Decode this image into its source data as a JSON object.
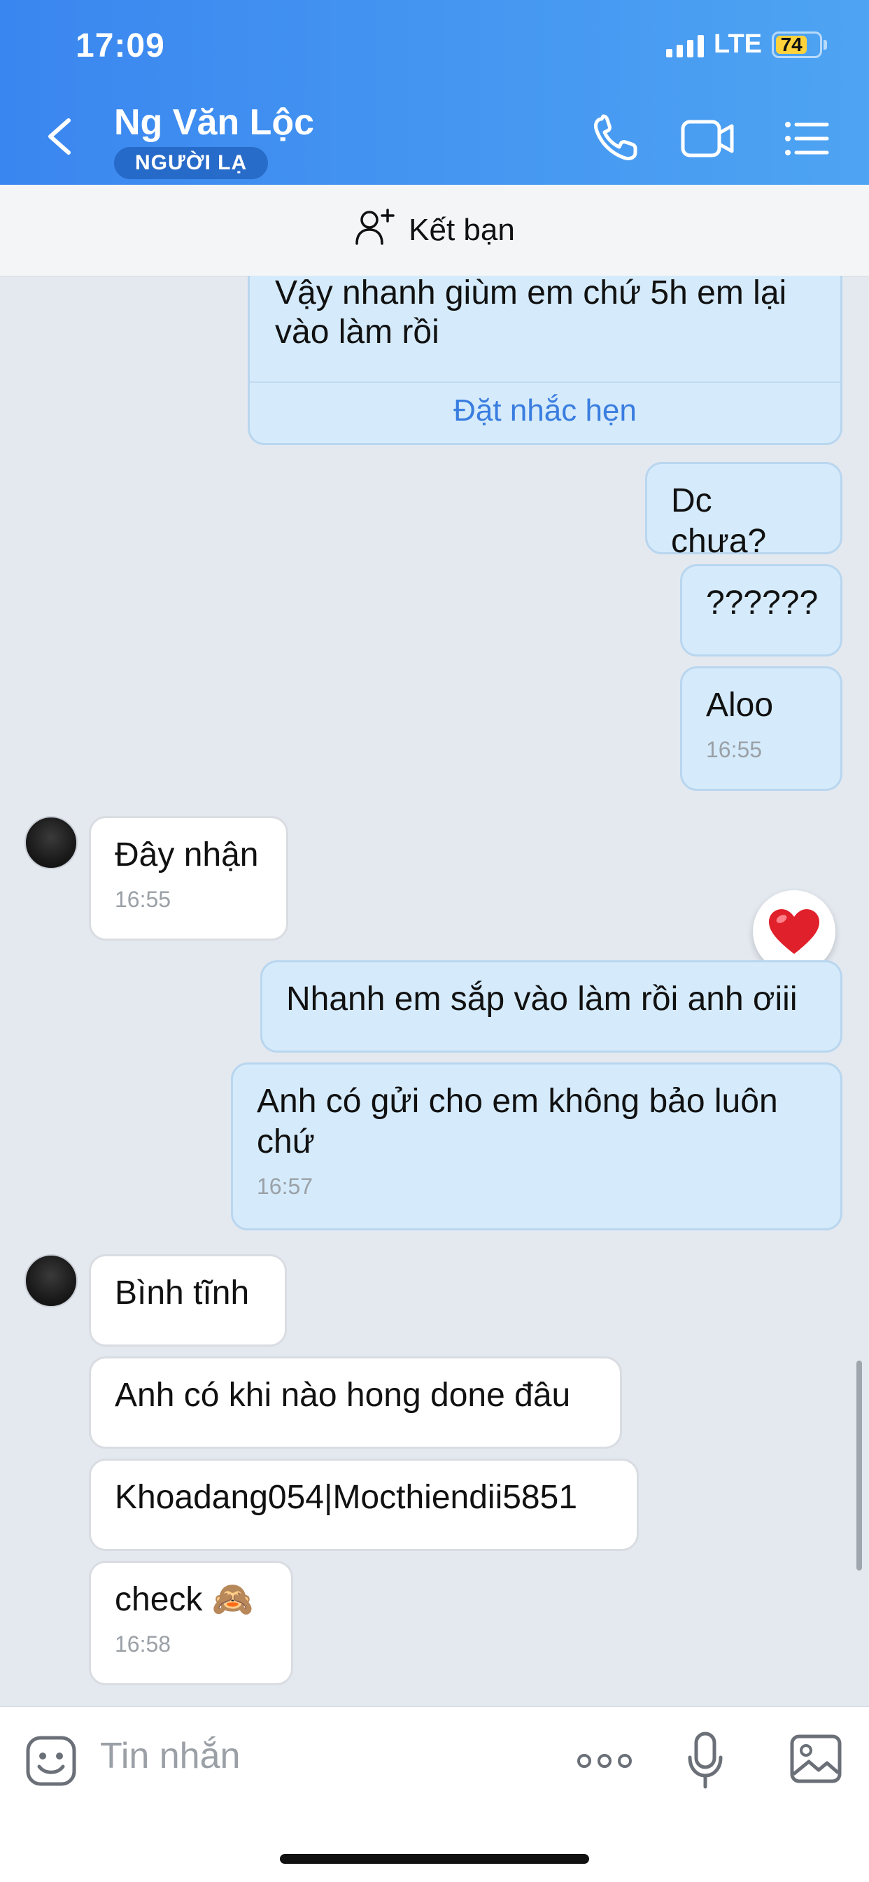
{
  "status_bar": {
    "time": "17:09",
    "network": "LTE",
    "battery": "74",
    "battery_level": 0.74
  },
  "header": {
    "contact_name": "Ng Văn Lộc",
    "badge": "NGƯỜI LẠ",
    "icons": [
      "back-chevron-icon",
      "phone-icon",
      "video-call-icon",
      "menu-list-icon"
    ],
    "accent_color": "#3a86f0"
  },
  "friend_bar": {
    "label": "Kết bạn",
    "icon": "add-person-icon"
  },
  "messages": [
    {
      "from": "me",
      "lines": [
        "Vậy nhanh giùm em chứ 5h em lại",
        "vào làm rồi"
      ],
      "action": "Đặt nhắc hẹn"
    },
    {
      "from": "me",
      "text": "Dc chưa?"
    },
    {
      "from": "me",
      "text": "??????"
    },
    {
      "from": "me",
      "text": "Aloo",
      "time": "16:55"
    },
    {
      "from": "them",
      "text": "Đây nhận",
      "time": "16:55",
      "avatar": true
    },
    {
      "from": "me",
      "text": "Nhanh em sắp vào làm rồi anh ơiii",
      "reaction": "heart-icon"
    },
    {
      "from": "me",
      "lines": [
        "Anh có gửi cho em không bảo luôn",
        "chứ"
      ],
      "time": "16:57"
    },
    {
      "from": "them",
      "text": "Bình tĩnh",
      "avatar": true
    },
    {
      "from": "them",
      "text": "Anh có khi nào hong done đâu"
    },
    {
      "from": "them",
      "text": "Khoadang054|Mocthiendii5851"
    },
    {
      "from": "them",
      "text": "check 🙈",
      "time": "16:58"
    }
  ],
  "composer": {
    "placeholder": "Tin nhắn",
    "icons": [
      "sticker-icon",
      "more-options-icon",
      "microphone-icon",
      "image-gallery-icon"
    ]
  },
  "colors": {
    "my_bubble": "#d5ebfb",
    "their_bubble": "#ffffff",
    "chat_bg": "#e4e9f0",
    "link": "#3a7de0"
  }
}
